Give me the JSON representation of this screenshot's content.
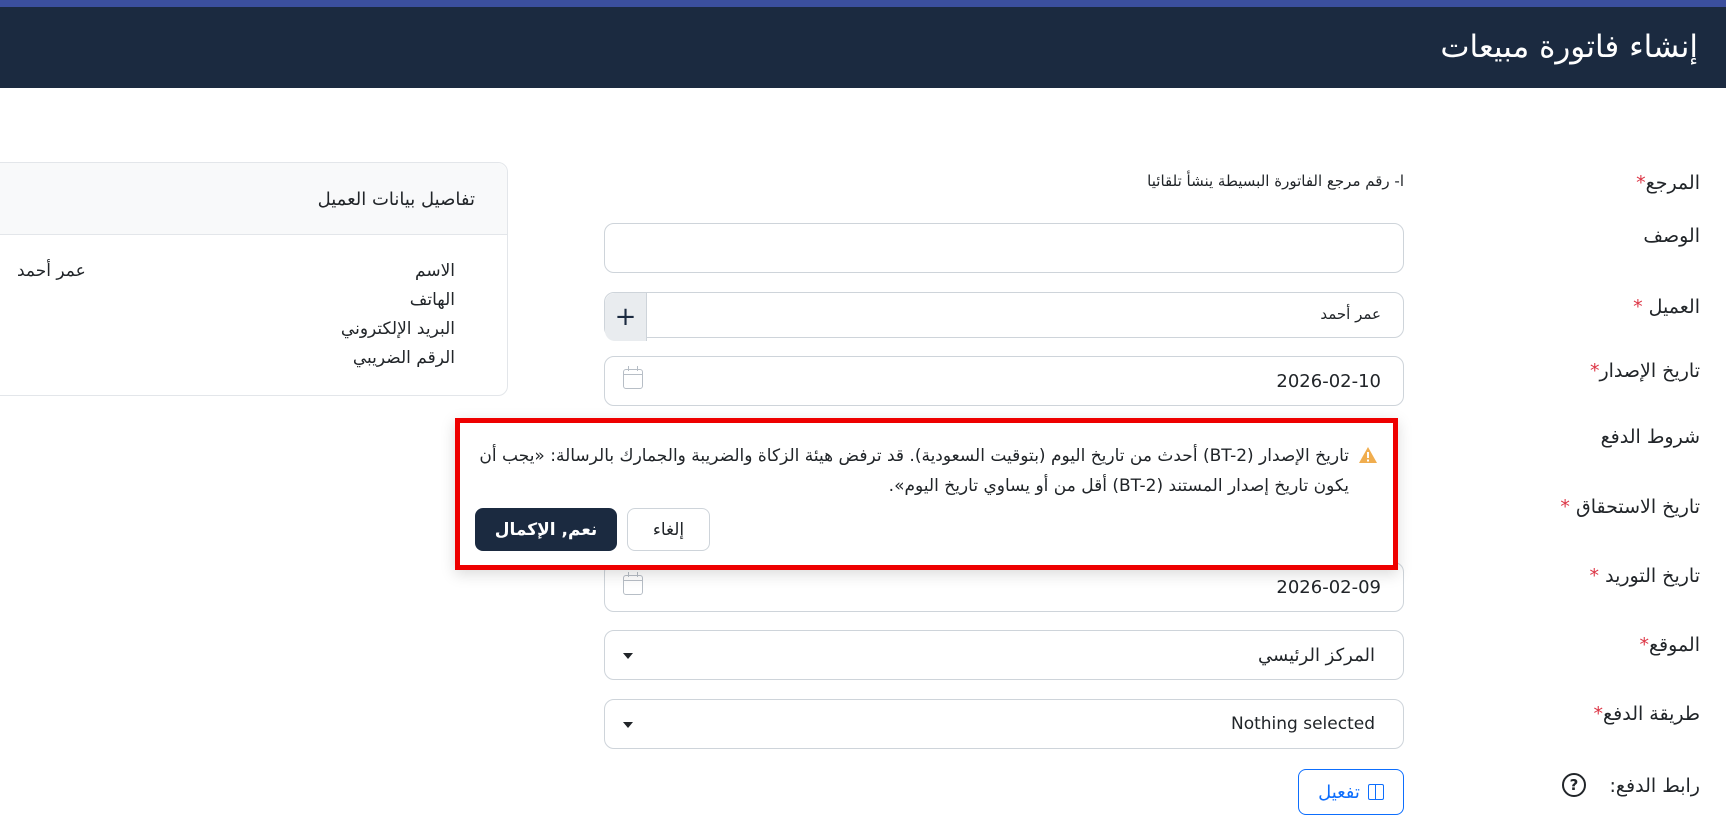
{
  "header": {
    "title": "إنشاء فاتورة مبيعات"
  },
  "form": {
    "reference": {
      "label": "المرجع",
      "required_mark": "*",
      "note": "ا- رقم مرجع الفاتورة البسيطة ينشأ تلقائيا"
    },
    "description": {
      "label": "الوصف",
      "value": ""
    },
    "customer": {
      "label": "العميل",
      "required_mark": "*",
      "value": "عمر أحمد",
      "add_symbol": "+"
    },
    "issue_date": {
      "label": "تاريخ الإصدار",
      "required_mark": "*",
      "value": "2026-02-10"
    },
    "payment_terms": {
      "label": "شروط الدفع"
    },
    "due_date": {
      "label": "تاريخ الاستحقاق",
      "required_mark": "*"
    },
    "supply_date": {
      "label": "تاريخ التوريد",
      "required_mark": "*",
      "value": "2026-02-09"
    },
    "location": {
      "label": "الموقع",
      "required_mark": "*",
      "value": "المركز الرئيسي"
    },
    "payment_method": {
      "label": "طريقة الدفع",
      "required_mark": "*",
      "value": "Nothing selected"
    },
    "payment_link": {
      "label": "رابط الدفع:",
      "help_symbol": "?",
      "activate_label": "تفعيل"
    }
  },
  "customer_card": {
    "title": "تفاصيل بيانات العميل",
    "fields": [
      {
        "label": "الاسم",
        "value": "عمر أحمد"
      },
      {
        "label": "الهاتف",
        "value": ""
      },
      {
        "label": "البريد الإلكتروني",
        "value": ""
      },
      {
        "label": "الرقم الضريبي",
        "value": ""
      }
    ]
  },
  "warning_popup": {
    "message": "تاريخ الإصدار (BT-2) أحدث من تاريخ اليوم (بتوقيت السعودية). قد ترفض هيئة الزكاة والضريبة والجمارك بالرسالة: «يجب أن يكون تاريخ إصدار المستند (BT-2) أقل من أو يساوي تاريخ اليوم».",
    "cancel_label": "إلغاء",
    "confirm_label": "نعم, الإكمال",
    "icon": "warning-triangle-icon",
    "highlight_color": "#ee0000"
  },
  "colors": {
    "header_bg": "#1b2a40",
    "accent": "#3b4f9e",
    "link_blue": "#0d6efd",
    "required": "#dc3545"
  }
}
